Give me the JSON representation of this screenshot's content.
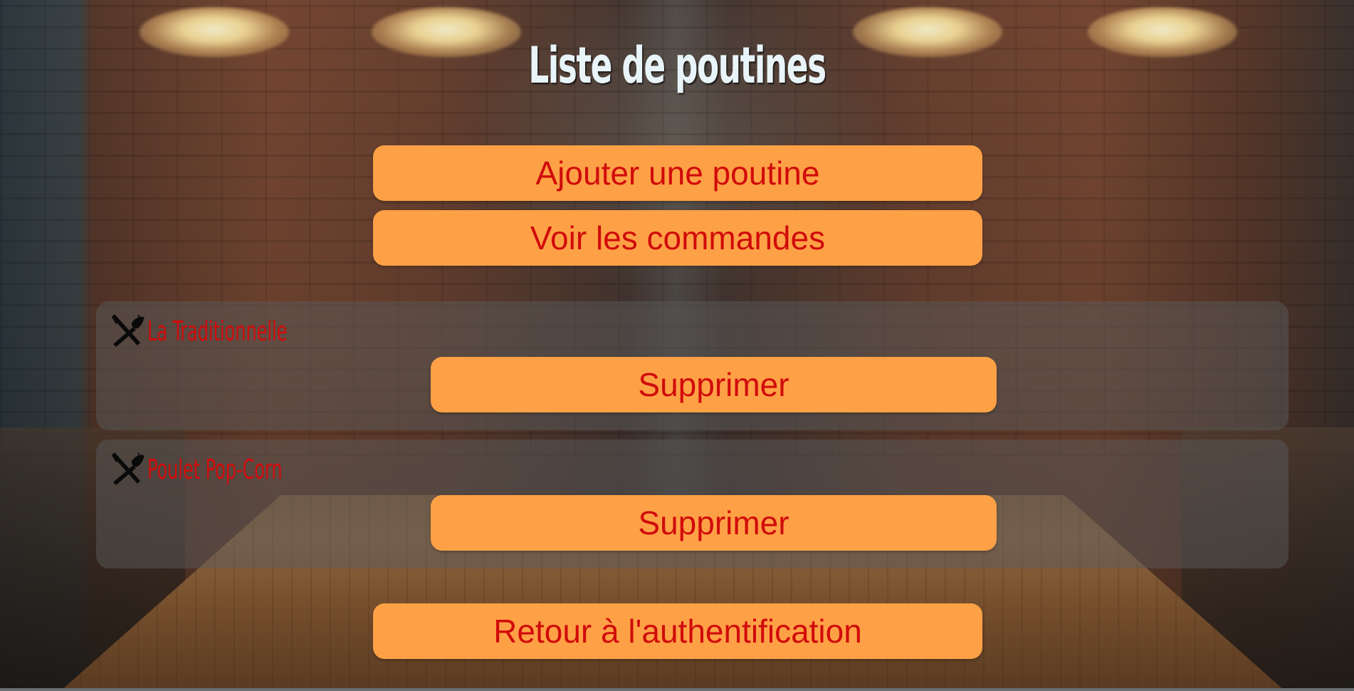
{
  "page": {
    "title": "Liste de poutines"
  },
  "actions": {
    "add_label": "Ajouter une poutine",
    "orders_label": "Voir les commandes",
    "back_label": "Retour à l'authentification"
  },
  "poutines": [
    {
      "name": "La Traditionnelle",
      "delete_label": "Supprimer",
      "icon": "fork-knife-icon"
    },
    {
      "name": "Poulet Pop-Corn",
      "delete_label": "Supprimer",
      "icon": "fork-knife-icon"
    }
  ],
  "colors": {
    "button_bg": "#fea146",
    "button_text": "#d10b0b",
    "title_text": "#e8f4f8",
    "card_bg": "rgba(90,90,90,0.5)"
  }
}
